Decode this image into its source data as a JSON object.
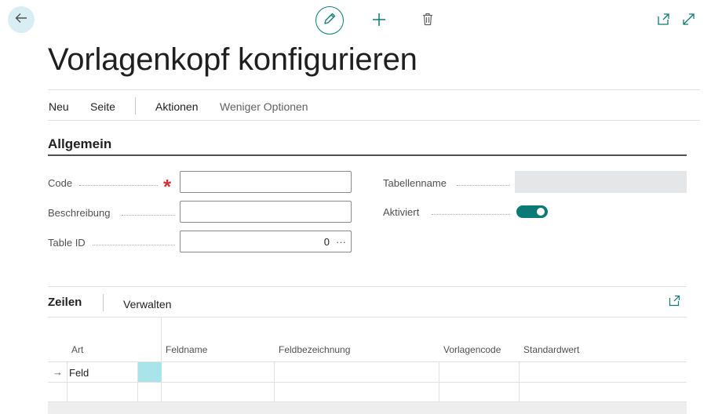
{
  "page": {
    "title": "Vorlagenkopf konfigurieren"
  },
  "toolbar_icons": [
    "back-arrow-icon",
    "pencil-icon",
    "plus-icon",
    "trash-icon",
    "open-new-window-icon",
    "expand-icon"
  ],
  "actions": {
    "neu": "Neu",
    "seite": "Seite",
    "aktionen": "Aktionen",
    "weniger_optionen": "Weniger Optionen"
  },
  "general": {
    "title": "Allgemein",
    "code_label": "Code",
    "code_value": "",
    "beschreibung_label": "Beschreibung",
    "beschreibung_value": "",
    "table_id_label": "Table ID",
    "table_id_value": "0",
    "table_id_lookup": "···",
    "tabellenname_label": "Tabellenname",
    "tabellenname_value": "",
    "aktiviert_label": "Aktiviert",
    "aktiviert_value": true
  },
  "lines": {
    "title": "Zeilen",
    "manage_label": "Verwalten",
    "columns": [
      "Art",
      "Feldname",
      "Feldbezeichnung",
      "Vorlagencode",
      "Standardwert"
    ],
    "rows": [
      {
        "marker": "→",
        "art": "Feld",
        "feldname": "",
        "feldbezeichnung": "",
        "vorlagencode": "",
        "standardwert": ""
      },
      {
        "marker": "",
        "art": "",
        "feldname": "",
        "feldbezeichnung": "",
        "vorlagencode": "",
        "standardwert": ""
      }
    ]
  },
  "colors": {
    "accent": "#0b7a75",
    "required": "#d13438",
    "back_button_bg": "#d9eef2",
    "selected_cell": "#a8e4ea"
  }
}
